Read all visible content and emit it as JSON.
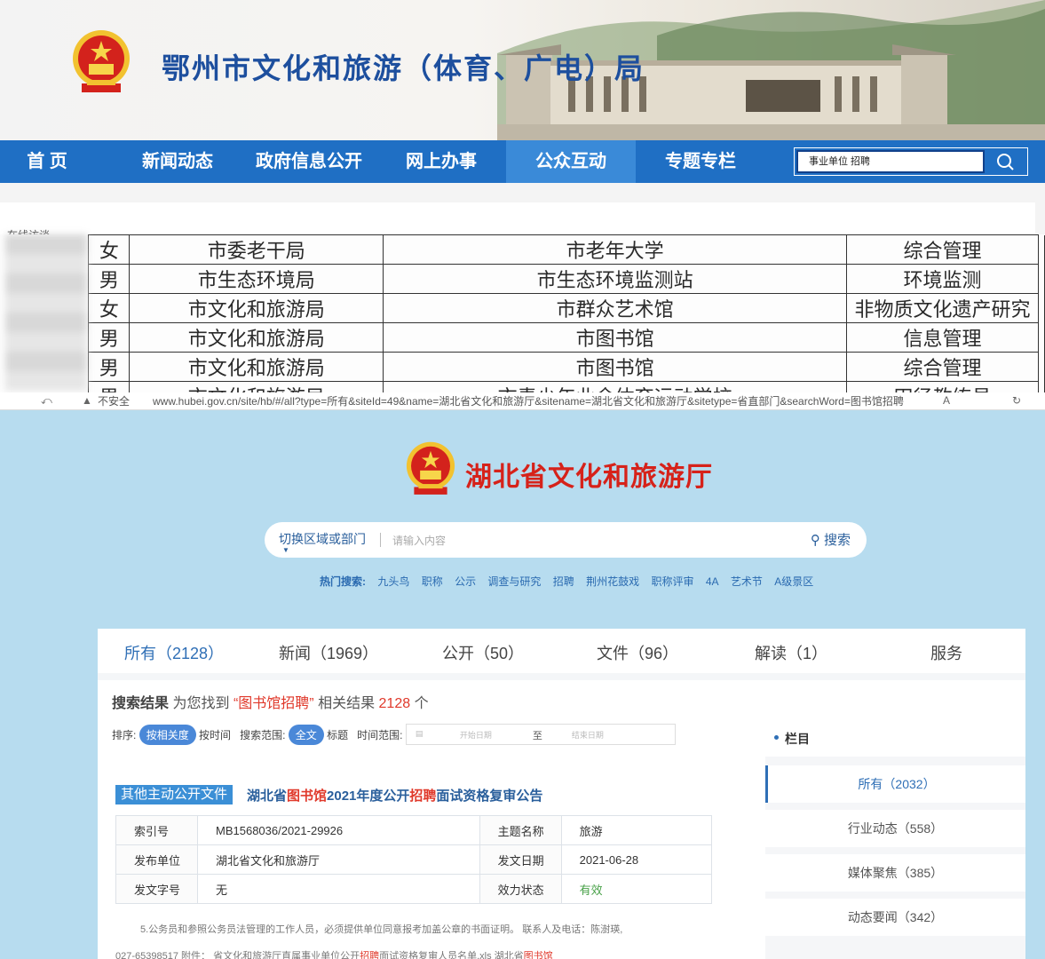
{
  "ezhou": {
    "title": "鄂州市文化和旅游（体育、广电）局",
    "nav": [
      {
        "label": "首 页"
      },
      {
        "label": "新闻动态"
      },
      {
        "label": "政府信息公开"
      },
      {
        "label": "网上办事"
      },
      {
        "label": "公众互动"
      },
      {
        "label": "专题专栏"
      }
    ],
    "active_nav": "公众互动",
    "search_value": "事业单位 招聘",
    "panel_label": "在线访谈",
    "table_rows": [
      {
        "gender": "女",
        "unit": "市委老干局",
        "employer": "市老年大学",
        "post": "综合管理"
      },
      {
        "gender": "男",
        "unit": "市生态环境局",
        "employer": "市生态环境监测站",
        "post": "环境监测"
      },
      {
        "gender": "女",
        "unit": "市文化和旅游局",
        "employer": "市群众艺术馆",
        "post": "非物质文化遗产研究"
      },
      {
        "gender": "男",
        "unit": "市文化和旅游局",
        "employer": "市图书馆",
        "post": "信息管理"
      },
      {
        "gender": "男",
        "unit": "市文化和旅游局",
        "employer": "市图书馆",
        "post": "综合管理"
      },
      {
        "gender": "男",
        "unit": "市文化和旅游局",
        "employer": "市青少年业余体育运动学校",
        "post": "田径教练员"
      }
    ]
  },
  "browser": {
    "security": "不安全",
    "url": "www.hubei.gov.cn/site/hb/#/all?type=所有&siteId=49&name=湖北省文化和旅游厅&sitename=湖北省文化和旅游厅&sitetype=省直部门&searchWord=图书馆招聘",
    "zoom": "A"
  },
  "hubei": {
    "title": "湖北省文化和旅游厅",
    "search": {
      "region_label": "切换区域或部门",
      "placeholder": "请输入内容",
      "button": "搜索"
    },
    "hot_label": "热门搜索:",
    "hot_terms": [
      "九头鸟",
      "职称",
      "公示",
      "调查与研究",
      "招聘",
      "荆州花鼓戏",
      "职称评审",
      "4A",
      "艺术节",
      "A级景区"
    ],
    "tabs": [
      {
        "label": "所有（2128）"
      },
      {
        "label": "新闻（1969）"
      },
      {
        "label": "公开（50）"
      },
      {
        "label": "文件（96）"
      },
      {
        "label": "解读（1）"
      },
      {
        "label": "服务"
      }
    ],
    "result": {
      "label": "搜索结果",
      "prefix": "为您找到",
      "keyword": "“图书馆招聘”",
      "middle": "相关结果",
      "count": "2128",
      "suffix": "个"
    },
    "sort": {
      "label": "排序:",
      "by_relevance": "按相关度",
      "by_time": "按时间",
      "scope_label": "搜索范围:",
      "scope_full": "全文",
      "scope_title": "标题",
      "range_label": "时间范围:",
      "start_placeholder": "开始日期",
      "to": "至",
      "end_placeholder": "结束日期"
    },
    "doc": {
      "tag": "其他主动公开文件",
      "title_a": "湖北省",
      "title_hl1": "图书馆",
      "title_b": "2021年度公开",
      "title_hl2": "招聘",
      "title_c": "面试资格复审公告",
      "meta": {
        "index_key": "索引号",
        "index_val": "MB1568036/2021-29926",
        "theme_key": "主题名称",
        "theme_val": "旅游",
        "issuer_key": "发布单位",
        "issuer_val": "湖北省文化和旅游厅",
        "date_key": "发文日期",
        "date_val": "2021-06-28",
        "docno_key": "发文字号",
        "docno_val": "无",
        "status_key": "效力状态",
        "status_val": "有效"
      },
      "snippet1": "5.公务员和参照公务员法管理的工作人员，必须提供单位同意报考加盖公章的书面证明。      联系人及电话：陈澍瑛,",
      "snippet2_a": "027-65398517      附件：         省文化和旅游厅直属事业单位公开",
      "snippet2_hl": "招聘",
      "snippet2_b": "面试资格复审人员名单.xls      湖北省",
      "snippet2_hl2": "图书馆"
    },
    "sidebar": {
      "head": "栏目",
      "items": [
        {
          "label": "所有（2032）"
        },
        {
          "label": "行业动态（558）"
        },
        {
          "label": "媒体聚焦（385）"
        },
        {
          "label": "动态要闻（342）"
        }
      ]
    }
  },
  "colors": {
    "ezhou_nav": "#1f6fc4",
    "ezhou_title": "#1d4f9e",
    "hubei_bg": "#b7dcef",
    "hubei_title": "#d6221a",
    "highlight": "#e0392b",
    "link_blue": "#2f6fb6",
    "status_green": "#48a148"
  }
}
